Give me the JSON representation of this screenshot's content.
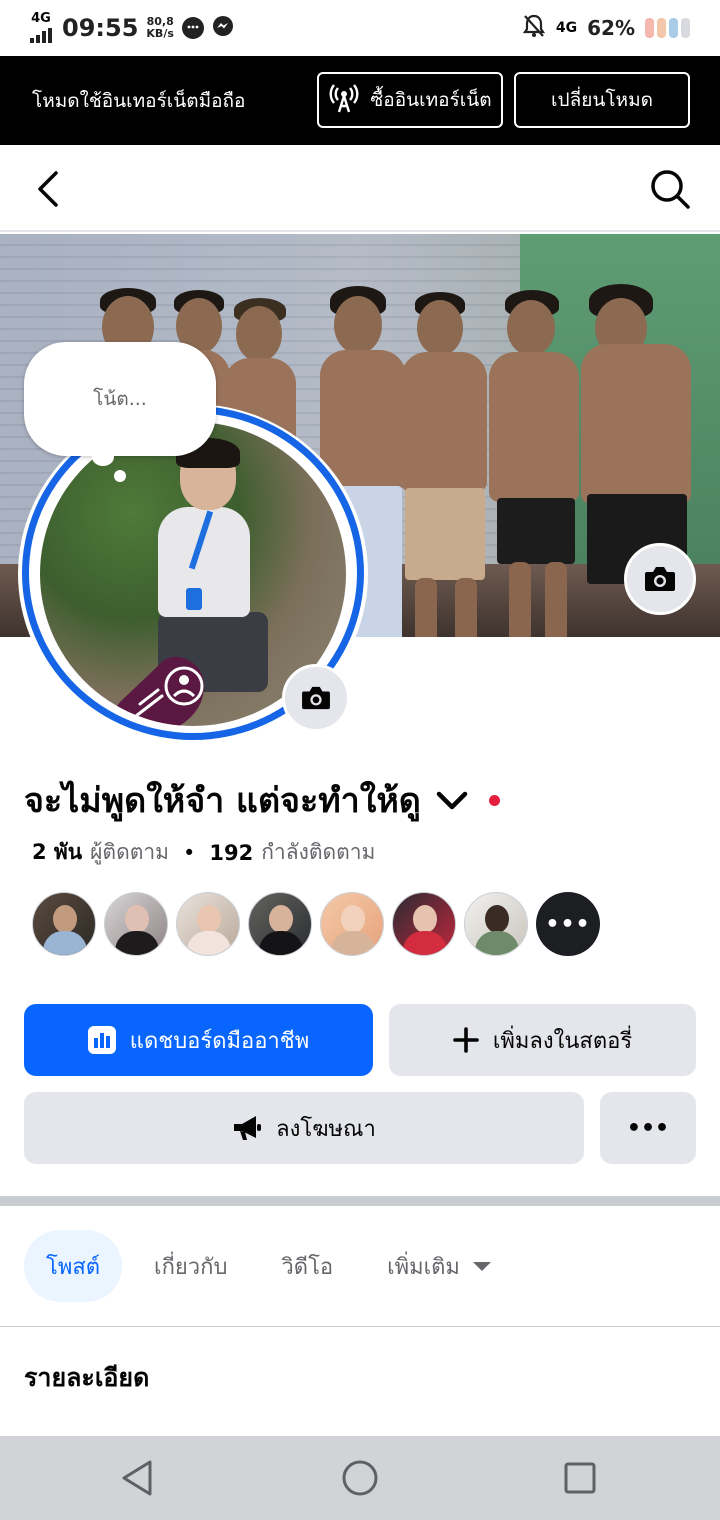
{
  "status_bar": {
    "network": "4G",
    "time": "09:55",
    "speed_value": "80,8",
    "speed_unit": "KB/s",
    "network_right": "4G",
    "battery": "62%",
    "icons": [
      "signal-icon",
      "chat-bubble-icon",
      "messenger-icon",
      "bell-off-icon",
      "battery-icon"
    ]
  },
  "data_banner": {
    "text": "โหมดใช้อินเทอร์เน็ตมือถือ",
    "buy_label": "ซื้ออินเทอร์เน็ต",
    "switch_label": "เปลี่ยนโหมด"
  },
  "profile": {
    "note_placeholder": "โน้ต...",
    "name": "จะไม่พูดให้จำ แต่จะทำให้ดู",
    "followers_count": "2 พัน",
    "followers_label": "ผู้ติดตาม",
    "separator": "•",
    "following_count": "192",
    "following_label": "กำลังติดตาม",
    "friends_more": "•••"
  },
  "actions": {
    "dashboard_label": "แดชบอร์ดมืออาชีพ",
    "add_story_label": "เพิ่มลงในสตอรี่",
    "advertise_label": "ลงโฆษณา",
    "more_label": "•••"
  },
  "tabs": [
    {
      "label": "โพสต์",
      "active": true
    },
    {
      "label": "เกี่ยวกับ",
      "active": false
    },
    {
      "label": "วิดีโอ",
      "active": false
    },
    {
      "label": "เพิ่มเติม",
      "active": false
    }
  ],
  "details_heading": "รายละเอียด",
  "colors": {
    "accent": "#0866ff",
    "ring": "#1565e6",
    "banner_bg": "#000000",
    "button_gray": "#e4e6eb",
    "red_dot": "#e41e3f"
  }
}
